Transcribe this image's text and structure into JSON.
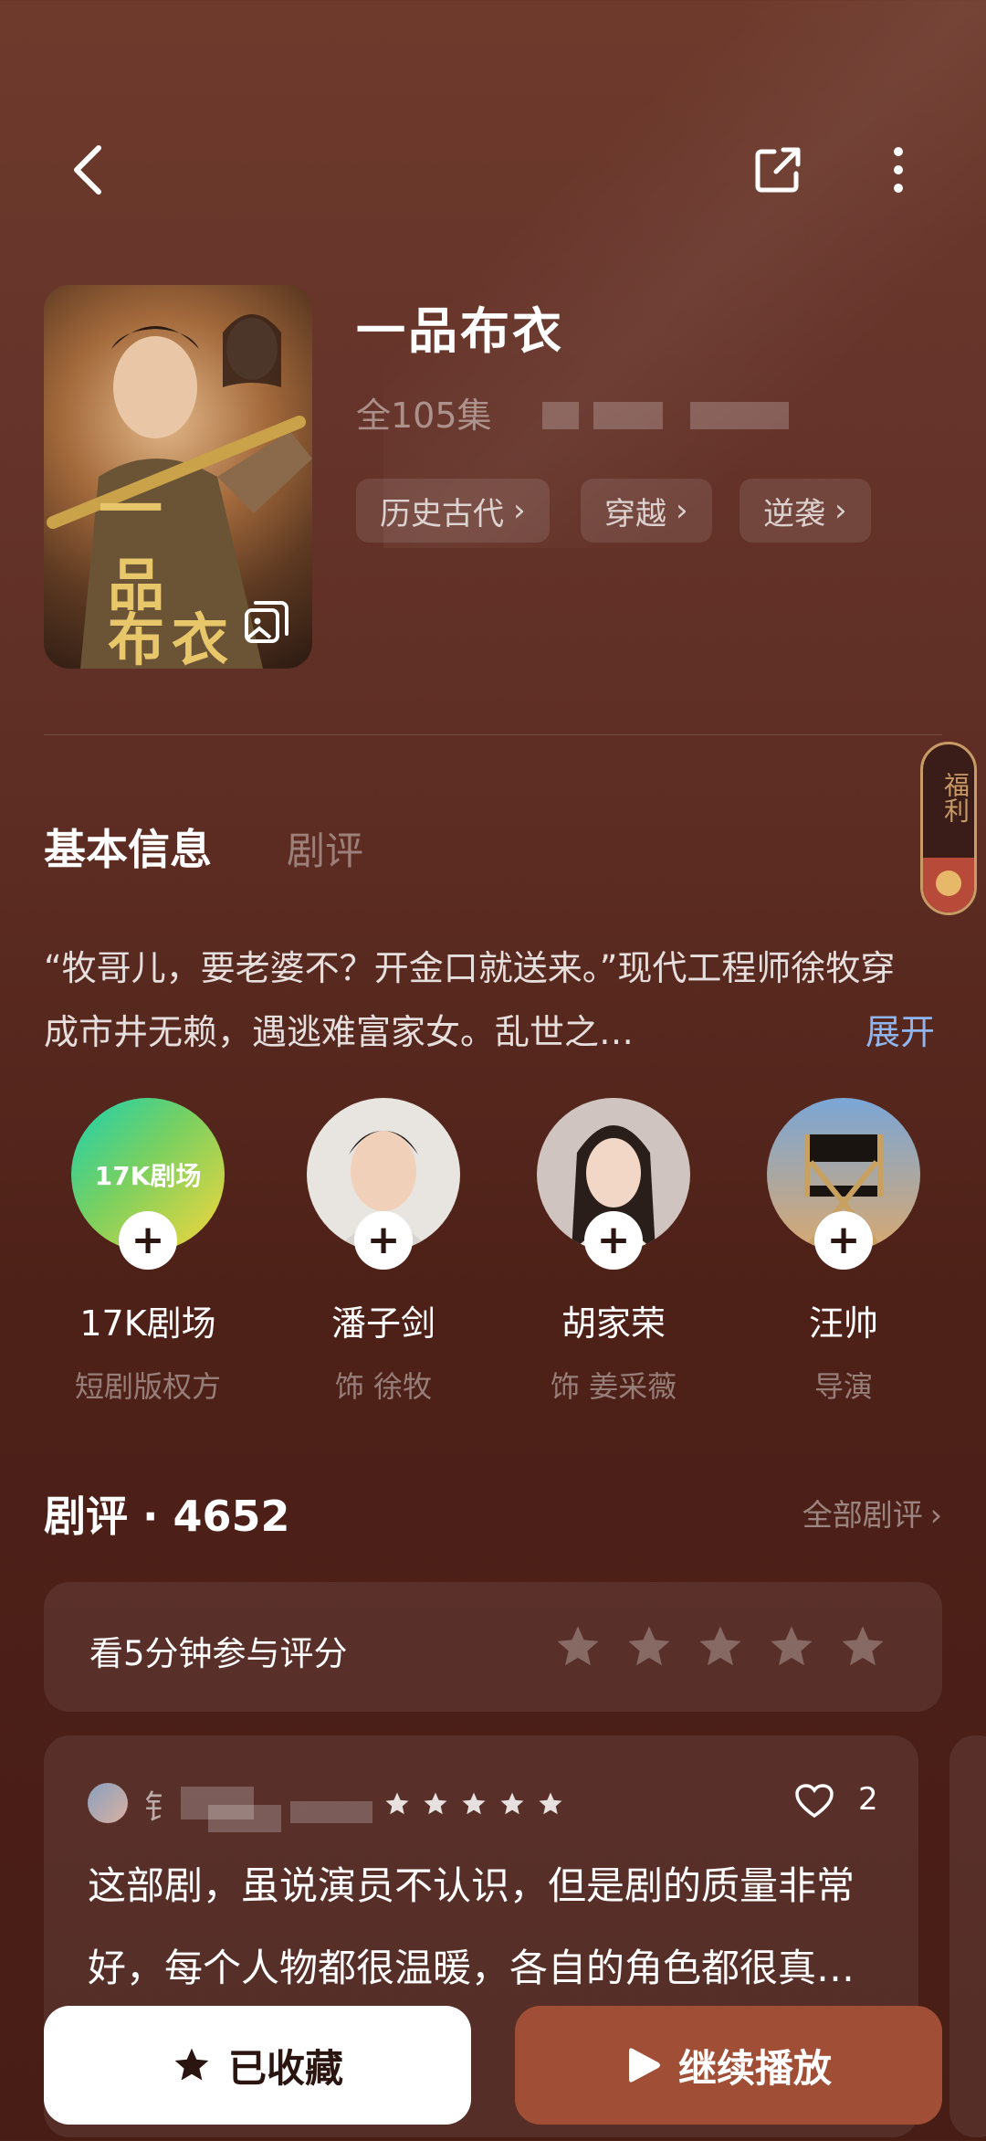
{
  "header": {
    "back_icon": "chevron-left-icon",
    "share_icon": "share-icon",
    "more_icon": "more-vertical-icon"
  },
  "show": {
    "title": "一品布衣",
    "episodes": "全105集",
    "tags": [
      "历史古代",
      "穿越",
      "逆袭"
    ]
  },
  "tabs": {
    "basic_info": "基本信息",
    "reviews": "剧评"
  },
  "welfare": "福利",
  "synopsis": {
    "text": "“牧哥儿，要老婆不？开金口就送来。”现代工程师徐牧穿成市井无赖，遇逃难富家女。乱世之…",
    "expand": "展开"
  },
  "cast": [
    {
      "name": "17K剧场",
      "role": "短剧版权方"
    },
    {
      "name": "潘子剑",
      "role": "饰 徐牧"
    },
    {
      "name": "胡家荣",
      "role": "饰 姜采薇"
    },
    {
      "name": "汪帅",
      "role": "导演"
    }
  ],
  "cast_logo_text": "17K剧场",
  "reviews": {
    "title": "剧评 · 4652",
    "all": "全部剧评",
    "rate_prompt": "看5分钟参与评分",
    "rating_stars": 5,
    "comment": {
      "user_initial": "钅",
      "user_rating": 5,
      "likes": "2",
      "text": "这部剧，虽说演员不认识，但是剧的质量非常好，每个人物都很温暖，各自的角色都很真… 演技好"
    }
  },
  "bottom": {
    "favorite": "已收藏",
    "continue": "继续播放"
  },
  "colors": {
    "accent_play": "#a04f36",
    "expand_link": "#8fb6f0",
    "background": "#5c2c22"
  }
}
